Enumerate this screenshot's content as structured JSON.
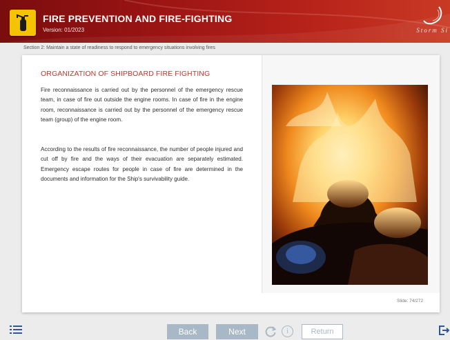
{
  "header": {
    "title": "FIRE PREVENTION AND FIRE-FIGHTING",
    "version": "Version: 01/2023",
    "brand": "Storm Si",
    "logo_icon": "fire-extinguisher-icon",
    "accent": "#9b1414"
  },
  "breadcrumb": "Section 2: Maintain a state of readiness to respond to emergency situations involving fires",
  "content": {
    "heading": "ORGANIZATION OF SHIPBOARD FIRE FIGHTING",
    "paragraph1": "Fire reconnaissance is carried out by the personnel of the emergency rescue team, in case of fire out outside the engine rooms. In case of fire in the engine room, reconnaissance is carried out by the personnel of the emergency rescue team (group) of the engine room.",
    "paragraph2": "According to the results of fire reconnaissance, the number of people injured and cut off by fire and the ways of their evacuation are separately estimated. Emergency escape routes for people in case of fire are determined in the documents and information for the Ship's survivability guide.",
    "slide": "Slide: 74/272"
  },
  "nav": {
    "back": "Back",
    "next": "Next",
    "return": "Return",
    "info": "i",
    "button_color": "#a9b8c6"
  }
}
